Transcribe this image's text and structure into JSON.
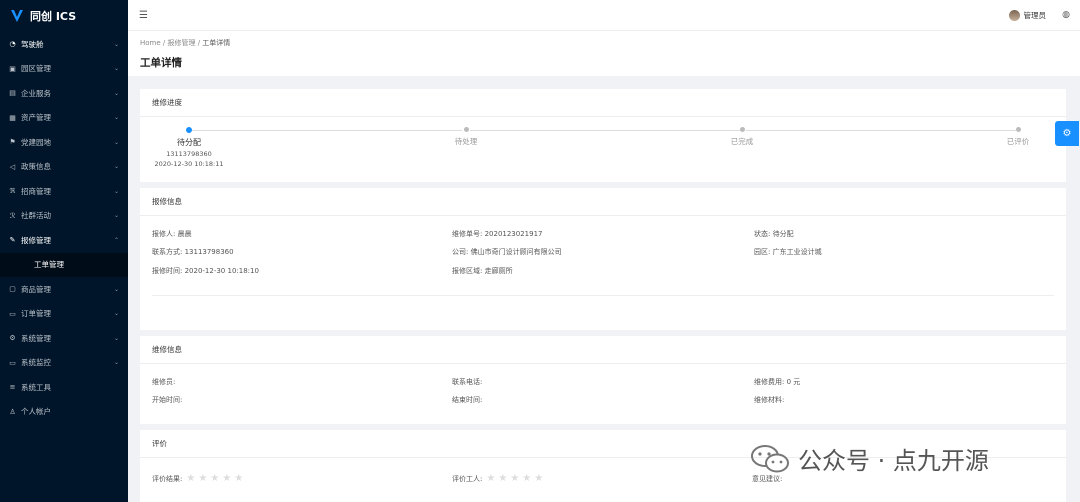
{
  "app": {
    "name": "同创 ICS"
  },
  "sidebar": {
    "items": [
      {
        "label": "驾驶舱",
        "icon": "dashboard-icon",
        "active": true
      },
      {
        "label": "园区管理",
        "icon": "park-icon"
      },
      {
        "label": "企业服务",
        "icon": "enterprise-icon"
      },
      {
        "label": "资产管理",
        "icon": "asset-icon"
      },
      {
        "label": "党建园地",
        "icon": "flag-icon"
      },
      {
        "label": "政策信息",
        "icon": "policy-icon"
      },
      {
        "label": "招商管理",
        "icon": "invest-icon"
      },
      {
        "label": "社群活动",
        "icon": "community-icon"
      },
      {
        "label": "报修管理",
        "icon": "wrench-icon",
        "expanded": true
      }
    ],
    "sub_items": [
      {
        "label": "工单管理"
      }
    ],
    "items2": [
      {
        "label": "商品管理",
        "icon": "goods-icon"
      },
      {
        "label": "订单管理",
        "icon": "order-icon"
      },
      {
        "label": "系统管理",
        "icon": "settings-icon"
      },
      {
        "label": "系统监控",
        "icon": "monitor-icon"
      },
      {
        "label": "系统工具",
        "icon": "tools-icon"
      },
      {
        "label": "个人帐户",
        "icon": "user-icon"
      }
    ]
  },
  "header": {
    "user": "管理员"
  },
  "breadcrumb": {
    "home": "Home",
    "parent": "报修管理",
    "current": "工单详情"
  },
  "page": {
    "title": "工单详情"
  },
  "progress": {
    "title": "维修进度",
    "steps": [
      {
        "label": "待分配",
        "sub1": "13113798360",
        "sub2": "2020-12-30 10:18:11"
      },
      {
        "label": "待处理"
      },
      {
        "label": "已完成"
      },
      {
        "label": "已评价"
      }
    ]
  },
  "repair_info": {
    "title": "报修信息",
    "reporter": "报修人: 晨晨",
    "order_no": "维修单号: 2020123021917",
    "status": "状态: 待分配",
    "contact": "联系方式: 13113798360",
    "company": "公司: 佛山市奇门设计顾问有限公司",
    "park": "园区: 广东工业设计城",
    "time": "报修时间: 2020-12-30 10:18:10",
    "area": "报修区域: 走廊厕所"
  },
  "maintain_info": {
    "title": "维修信息",
    "worker": "维修员:",
    "phone": "联系电话:",
    "fee": "维修费用: 0 元",
    "start": "开始时间:",
    "end": "结束时间:",
    "material": "维修材料:"
  },
  "review": {
    "title": "评价",
    "result": "评价结果:",
    "worker": "评价工人:",
    "advice": "意见建议:",
    "stars": "★★★★★"
  },
  "watermark": {
    "text": "公众号 · 点九开源"
  }
}
